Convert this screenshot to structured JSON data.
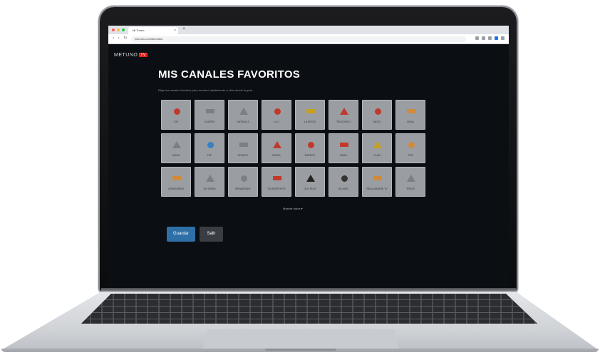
{
  "browser": {
    "tab_title": "Mi Tuneo",
    "tab_close": "×",
    "new_tab": "+",
    "nav_buttons": "‹ › ↻",
    "url": "mituneo.com/favoritos"
  },
  "app": {
    "logo_text": "METUNO",
    "logo_badge": "TV",
    "page_title": "MIS CANALES FAVORITOS",
    "subtitle": "Elige tus canales favoritos para acceder rápidamente a ellos desde la guía",
    "more_link": "Mostrar todos ▾",
    "save_label": "Guardar",
    "exit_label": "Salir"
  },
  "channels": [
    {
      "label": "TVE",
      "icon": "person-icon",
      "color": "#c0392b"
    },
    {
      "label": "CUATRO",
      "icon": "cuatro-icon",
      "color": "#7a7f85"
    },
    {
      "label": "ANTENA 3",
      "icon": "antena3-icon",
      "color": "#7a7f85"
    },
    {
      "label": "LA 2",
      "icon": "check-icon",
      "color": "#c0392b"
    },
    {
      "label": "LA SEXTA",
      "icon": "lasexta-icon",
      "color": "#c8a020"
    },
    {
      "label": "TELECINCO",
      "icon": "telecinco-icon",
      "color": "#c0392b"
    },
    {
      "label": "NEOX",
      "icon": "neox-icon",
      "color": "#c0392b"
    },
    {
      "label": "NOVA",
      "icon": "nova-icon",
      "color": "#d08a3a"
    },
    {
      "label": "MEGA",
      "icon": "mega-icon",
      "color": "#7a7f85"
    },
    {
      "label": "FDF",
      "icon": "fdf-icon",
      "color": "#3a7fc0"
    },
    {
      "label": "DIVINITY",
      "icon": "divinity-icon",
      "color": "#7a7f85"
    },
    {
      "label": "BOING",
      "icon": "boing-icon",
      "color": "#c0392b"
    },
    {
      "label": "ENERGY",
      "icon": "energy-icon",
      "color": "#c0392b"
    },
    {
      "label": "DMAX",
      "icon": "dmax-icon",
      "color": "#c0392b"
    },
    {
      "label": "CLAN",
      "icon": "clan-icon",
      "color": "#c8a020"
    },
    {
      "label": "TEN",
      "icon": "ten-icon",
      "color": "#d08a3a"
    },
    {
      "label": "ATRESERIES",
      "icon": "atreseries-icon",
      "color": "#d08a3a"
    },
    {
      "label": "24 HORAS",
      "icon": "24h-icon",
      "color": "#7a7f85"
    },
    {
      "label": "PARAMOUNT",
      "icon": "paramount-icon",
      "color": "#7a7f85"
    },
    {
      "label": "TELEDEPORTE",
      "icon": "teledeporte-icon",
      "color": "#c0392b"
    },
    {
      "label": "GOL PLAY",
      "icon": "golplay-icon",
      "color": "#222222"
    },
    {
      "label": "BE MAD",
      "icon": "bemad-icon",
      "color": "#333333"
    },
    {
      "label": "REAL MADRID TV",
      "icon": "realmadrid-icon",
      "color": "#d08a3a"
    },
    {
      "label": "TRECE",
      "icon": "trece-icon",
      "color": "#7a7f85"
    }
  ],
  "colors": {
    "accent": "#2f6fa8",
    "background": "#0b0f14",
    "tile": "#9a9ea3"
  }
}
